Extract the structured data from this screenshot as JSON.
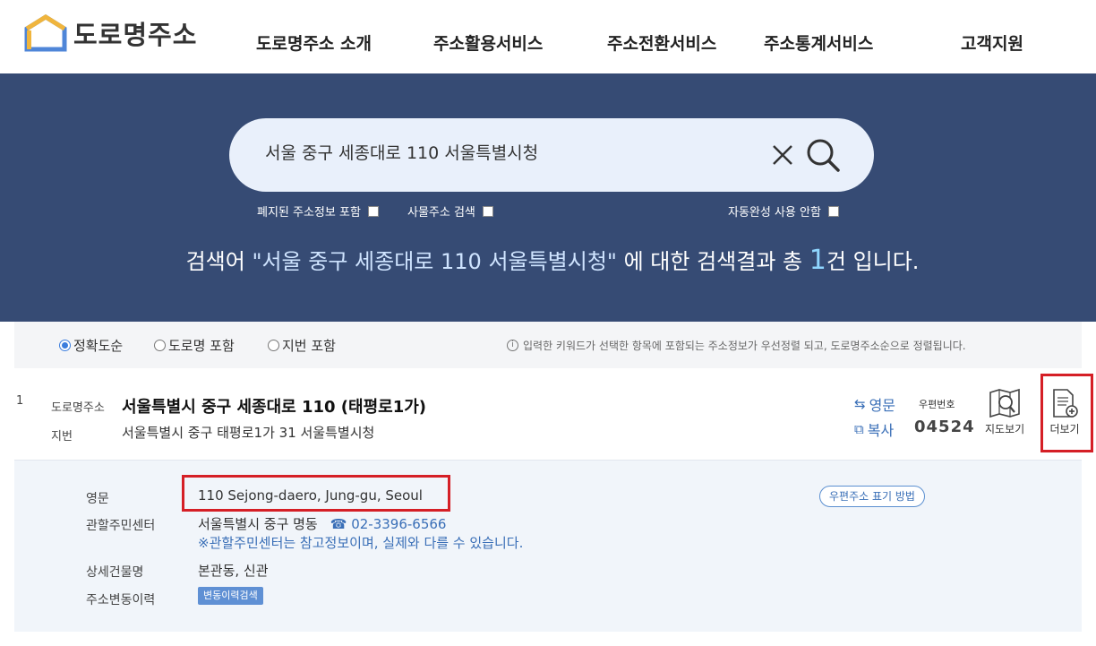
{
  "header": {
    "logo_text": "도로명주소",
    "nav": [
      "도로명주소 소개",
      "주소활용서비스",
      "주소전환서비스",
      "주소통계서비스",
      "고객지원"
    ]
  },
  "search": {
    "value": "서울 중구 세종대로 110 서울특별시청",
    "clear_icon": "close-icon",
    "search_icon": "search-icon",
    "options": {
      "include_abolished": "폐지된 주소정보 포함",
      "thing_address": "사물주소 검색",
      "no_autocomplete": "자동완성 사용 안함"
    }
  },
  "result_message": {
    "prefix": "검색어 ",
    "keyword": "\"서울 중구 세종대로 110 서울특별시청\"",
    "middle": " 에 대한 검색결과 총 ",
    "count": "1",
    "suffix": "건 입니다."
  },
  "filters": {
    "radios": [
      "정확도순",
      "도로명 포함",
      "지번 포함"
    ],
    "selected": "정확도순",
    "notice": "입력한 키워드가 선택한 항목에 포함되는 주소정보가 우선정렬 되고, 도로명주소순으로 정렬됩니다."
  },
  "result": {
    "number": "1",
    "road_label": "도로명주소",
    "road_address": "서울특별시 중구 세종대로 110 (태평로1가)",
    "jibun_label": "지번",
    "jibun_address": "서울특별시 중구 태평로1가 31 서울특별시청",
    "english_link": "영문",
    "copy_link": "복사",
    "postal_label": "우편번호",
    "postal_code": "04524",
    "map_label": "지도보기",
    "more_label": "더보기"
  },
  "detail": {
    "english_label": "영문",
    "english_value": "110 Sejong-daero, Jung-gu, Seoul",
    "center_label": "관할주민센터",
    "center_value": "서울특별시 중구 명동",
    "center_phone": "☎ 02-3396-6566",
    "center_note": "※관할주민센터는 참고정보이며, 실제와 다를 수 있습니다.",
    "building_label": "상세건물명",
    "building_value": "본관동, 신관",
    "history_label": "주소변동이력",
    "history_button": "변동이력검색",
    "postal_display_button": "우편주소 표기 방법"
  },
  "colors": {
    "hero_bg": "#364b74",
    "accent_blue": "#3a6fb7",
    "highlight_red": "#d51f26"
  }
}
